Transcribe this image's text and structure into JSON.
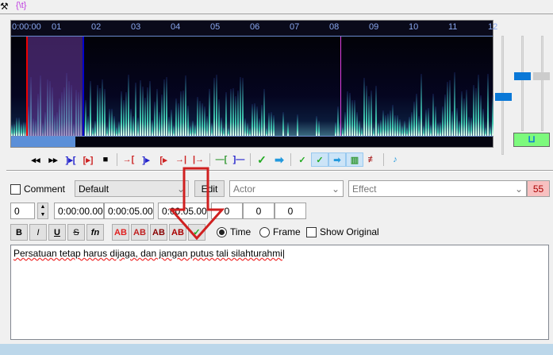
{
  "top": {
    "tag_label": "{\\t}"
  },
  "audio": {
    "ruler": [
      "0:00:00",
      "01",
      "02",
      "03",
      "04",
      "05",
      "06",
      "07",
      "08",
      "09",
      "10",
      "11",
      "12"
    ],
    "accent": "#5b8fd8"
  },
  "edit": {
    "comment_label": "Comment",
    "style": "Default",
    "edit_label": "Edit",
    "actor_placeholder": "Actor",
    "effect_placeholder": "Effect",
    "char_count": "55",
    "layer": "0",
    "start": "0:00:00.00",
    "end": "0:00:05.00",
    "duration": "0:00:05.00",
    "margin_l": "0",
    "margin_r": "0",
    "margin_v": "0",
    "format": {
      "bold": "B",
      "italic": "I",
      "underline": "U",
      "strike": "S",
      "font": "fn",
      "colors": [
        "AB",
        "AB",
        "AB",
        "AB"
      ]
    },
    "time_label": "Time",
    "frame_label": "Frame",
    "show_original_label": "Show Original",
    "text": "Persatuan tetap harus dijaga, dan jangan putus tali silahturahmi"
  }
}
